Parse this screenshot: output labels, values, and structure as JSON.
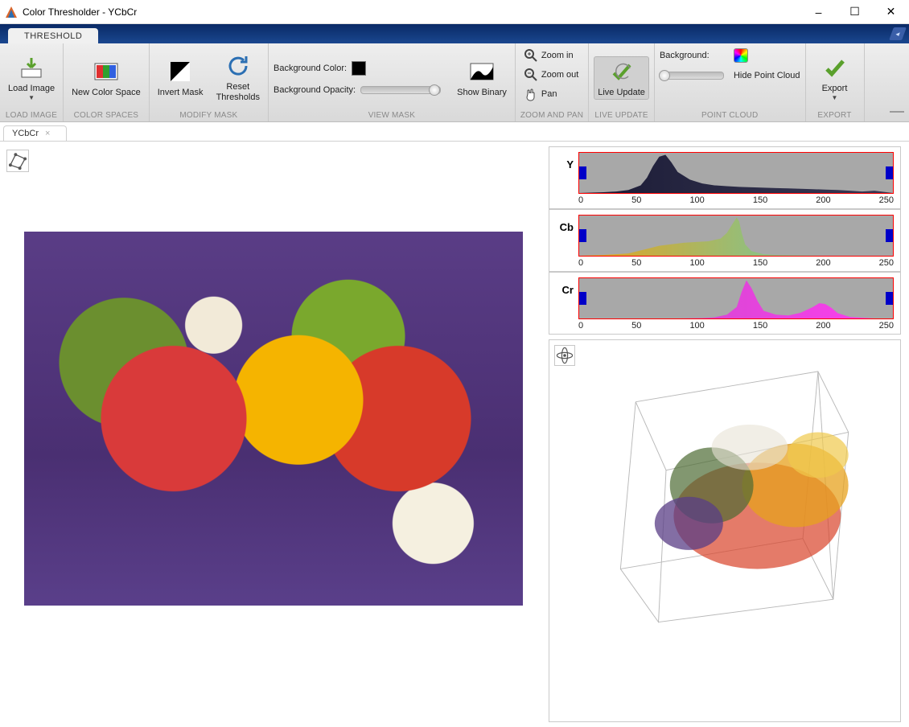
{
  "window": {
    "title": "Color Thresholder - YCbCr",
    "minimize": "–",
    "maximize": "☐",
    "close": "✕"
  },
  "ribbon": {
    "tab": "THRESHOLD"
  },
  "toolstrip": {
    "groups": {
      "load": {
        "label": "LOAD IMAGE",
        "button": "Load Image"
      },
      "colorspaces": {
        "label": "COLOR SPACES",
        "button": "New Color Space"
      },
      "modifymask": {
        "label": "MODIFY MASK",
        "invert": "Invert Mask",
        "reset": "Reset\nThresholds"
      },
      "viewmask": {
        "label": "VIEW MASK",
        "bgcolor": "Background Color:",
        "bgopacity": "Background Opacity:",
        "bgopacity_value": 100,
        "showbinary": "Show Binary"
      },
      "zoompan": {
        "label": "ZOOM AND PAN",
        "zoomin": "Zoom in",
        "zoomout": "Zoom out",
        "pan": "Pan"
      },
      "liveupdate": {
        "label": "LIVE UPDATE",
        "button": "Live Update"
      },
      "pointcloud": {
        "label": "POINT CLOUD",
        "background": "Background:",
        "background_value": 0,
        "hide": "Hide Point Cloud"
      },
      "export": {
        "label": "EXPORT",
        "button": "Export"
      }
    }
  },
  "doctab": {
    "title": "YCbCr"
  },
  "channels": [
    {
      "name": "Y",
      "ticks": [
        "0",
        "50",
        "100",
        "150",
        "200",
        "250"
      ],
      "min": 0,
      "max": 255,
      "lo": 0,
      "hi": 255
    },
    {
      "name": "Cb",
      "ticks": [
        "0",
        "50",
        "100",
        "150",
        "200",
        "250"
      ],
      "min": 0,
      "max": 255,
      "lo": 0,
      "hi": 255
    },
    {
      "name": "Cr",
      "ticks": [
        "0",
        "50",
        "100",
        "150",
        "200",
        "250"
      ],
      "min": 0,
      "max": 255,
      "lo": 0,
      "hi": 255
    }
  ],
  "image": {
    "description": "Photograph of assorted bell peppers, chili peppers and garlic on a purple cloth background (MATLAB peppers.png sample image)"
  },
  "pointcloud": {
    "description": "3-D scatter of image pixels in YCbCr space inside a wireframe cube"
  },
  "chart_data": [
    {
      "type": "area",
      "title": "Y channel histogram",
      "xlabel": "",
      "ylabel": "",
      "xlim": [
        0,
        255
      ],
      "x": [
        0,
        10,
        20,
        30,
        40,
        50,
        55,
        60,
        65,
        70,
        75,
        80,
        90,
        100,
        110,
        120,
        130,
        140,
        150,
        160,
        170,
        180,
        190,
        200,
        210,
        220,
        230,
        240,
        250,
        255
      ],
      "values": [
        0,
        1,
        2,
        4,
        8,
        20,
        40,
        70,
        95,
        100,
        80,
        55,
        35,
        25,
        20,
        18,
        16,
        15,
        14,
        13,
        12,
        11,
        10,
        9,
        8,
        6,
        4,
        6,
        2,
        0
      ]
    },
    {
      "type": "area",
      "title": "Cb channel histogram",
      "xlabel": "",
      "ylabel": "",
      "xlim": [
        0,
        255
      ],
      "x": [
        0,
        20,
        40,
        55,
        65,
        75,
        85,
        95,
        105,
        115,
        120,
        125,
        128,
        130,
        132,
        135,
        140,
        150,
        160,
        180,
        200,
        220,
        240,
        255
      ],
      "values": [
        0,
        2,
        6,
        18,
        26,
        30,
        34,
        36,
        38,
        45,
        60,
        85,
        100,
        90,
        60,
        30,
        12,
        4,
        2,
        1,
        0,
        0,
        0,
        0
      ]
    },
    {
      "type": "area",
      "title": "Cr channel histogram",
      "xlabel": "",
      "ylabel": "",
      "xlim": [
        0,
        255
      ],
      "x": [
        0,
        40,
        80,
        100,
        110,
        120,
        128,
        132,
        136,
        140,
        145,
        150,
        160,
        170,
        180,
        190,
        195,
        200,
        205,
        210,
        220,
        240,
        255
      ],
      "values": [
        0,
        0,
        0,
        1,
        3,
        10,
        30,
        70,
        100,
        80,
        45,
        20,
        10,
        8,
        15,
        30,
        40,
        38,
        28,
        14,
        4,
        0,
        0
      ]
    }
  ]
}
